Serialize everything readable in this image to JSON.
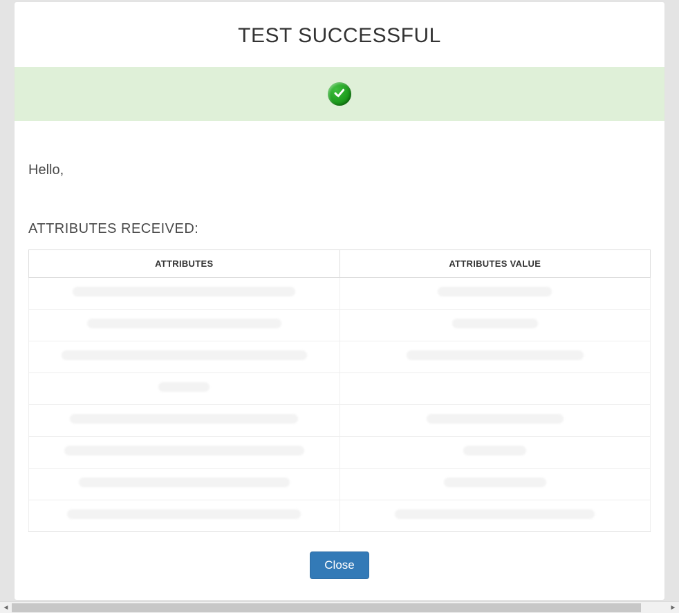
{
  "title": "TEST SUCCESSFUL",
  "success_icon": "check-circle-icon",
  "greeting": "Hello,",
  "section_heading": "ATTRIBUTES RECEIVED:",
  "table": {
    "headers": {
      "attributes": "ATTRIBUTES",
      "values": "ATTRIBUTES VALUE"
    },
    "rows": [
      {
        "attribute": "",
        "value": ""
      },
      {
        "attribute": "",
        "value": ""
      },
      {
        "attribute": "",
        "value": ""
      },
      {
        "attribute": "",
        "value": ""
      },
      {
        "attribute": "",
        "value": ""
      },
      {
        "attribute": "",
        "value": ""
      },
      {
        "attribute": "",
        "value": ""
      },
      {
        "attribute": "",
        "value": ""
      }
    ]
  },
  "buttons": {
    "close": "Close"
  },
  "colors": {
    "success_band": "#dff0d8",
    "primary_button": "#337ab7",
    "check_green": "#1f9e1f"
  }
}
